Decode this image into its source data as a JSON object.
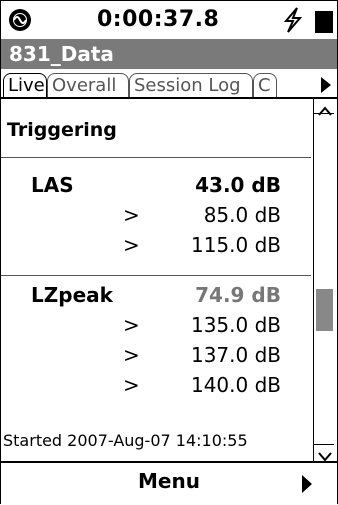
{
  "status": {
    "time": "0:00:37.8",
    "logo_icon": "circle-waveform-icon",
    "power_icon": "lightning-icon",
    "battery_icon": "battery-icon"
  },
  "title": "831_Data",
  "tabs": [
    {
      "label": "Live",
      "active": true
    },
    {
      "label": "Overall",
      "active": false
    },
    {
      "label": "Session Log",
      "active": false
    },
    {
      "label": "C",
      "active": false
    }
  ],
  "section_title": "Triggering",
  "groups": [
    {
      "name": "LAS",
      "value": "43.0 dB",
      "thresholds": [
        {
          "symbol": ">",
          "value": "85.0 dB"
        },
        {
          "symbol": ">",
          "value": "115.0 dB"
        }
      ]
    },
    {
      "name": "LZpeak",
      "value": "74.9 dB",
      "thresholds": [
        {
          "symbol": ">",
          "value": "135.0 dB"
        },
        {
          "symbol": ">",
          "value": "137.0 dB"
        },
        {
          "symbol": ">",
          "value": "140.0 dB"
        }
      ]
    }
  ],
  "started": "Started 2007-Aug-07 14:10:55",
  "menu_label": "Menu",
  "colors": {
    "titlebar": "#7a7a7a",
    "gray_value": "#777777"
  }
}
